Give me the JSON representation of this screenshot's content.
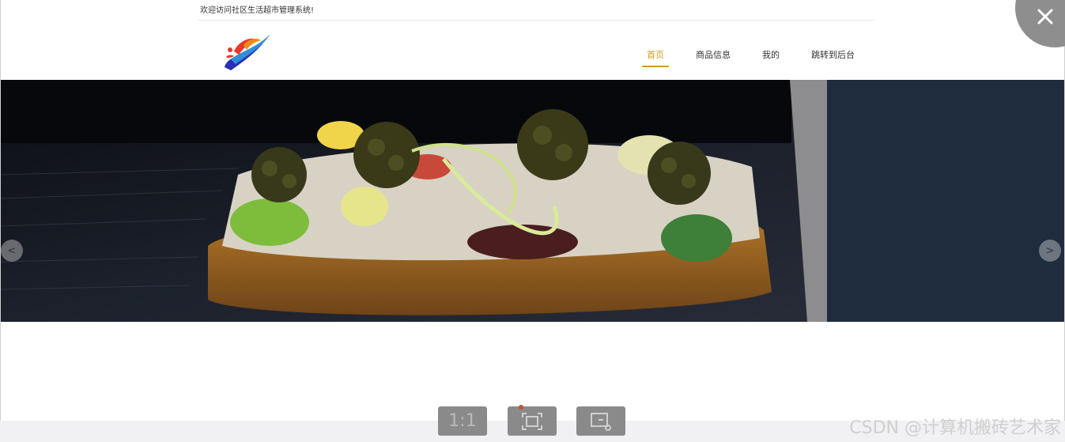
{
  "top_bar": {
    "welcome_text": "欢迎访问社区生活超市管理系统!"
  },
  "header": {
    "logo_icon": "brand-swirl-logo",
    "nav": [
      {
        "label": "首页",
        "active": true
      },
      {
        "label": "商品信息",
        "active": false
      },
      {
        "label": "我的",
        "active": false
      },
      {
        "label": "跳转到后台",
        "active": false
      }
    ],
    "accent_color": "#d79a1a"
  },
  "banner": {
    "image": "caviar-toast-on-slate",
    "prev_icon": "<",
    "next_icon": ">"
  },
  "viewer": {
    "close_icon": "close-icon",
    "tools": [
      {
        "label": "1:1",
        "icon": "actual-size-icon"
      },
      {
        "label": "",
        "icon": "fit-screen-icon"
      },
      {
        "label": "",
        "icon": "crop-icon"
      }
    ]
  },
  "watermark": "CSDN @计算机搬砖艺术家"
}
